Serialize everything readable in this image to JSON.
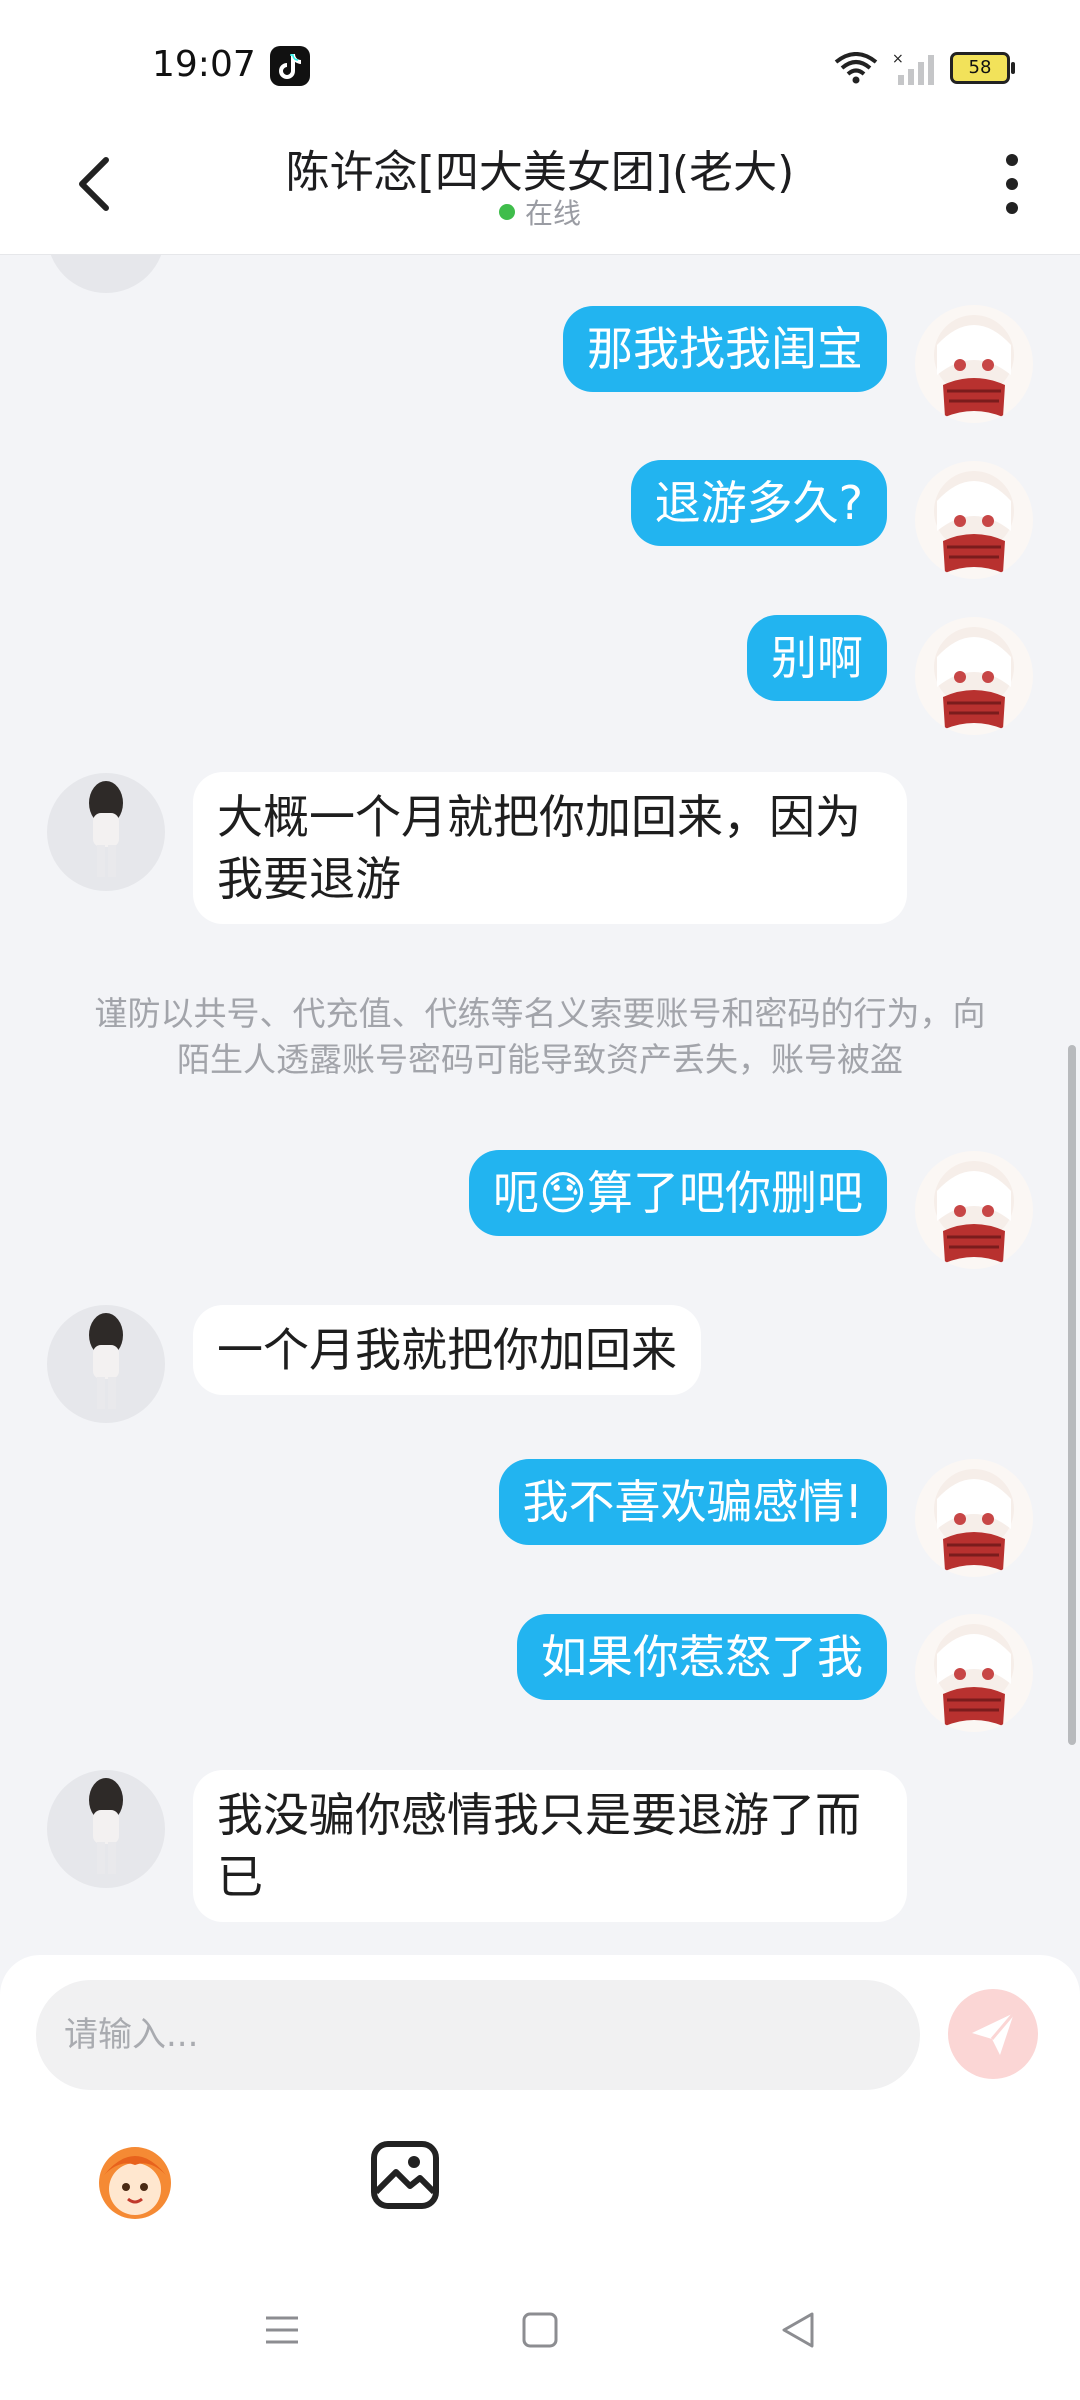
{
  "status_bar": {
    "time": "19:07",
    "battery": "58",
    "icons": [
      "tiktok-icon",
      "wifi-icon",
      "signal-icon",
      "battery-icon"
    ]
  },
  "header": {
    "title": "陈许念[四大美女团](老大)",
    "status": "在线",
    "status_color": "#3fbd4b"
  },
  "messages": [
    {
      "side": "me",
      "text": "那我找我闺宝"
    },
    {
      "side": "me",
      "text": "退游多久?"
    },
    {
      "side": "me",
      "text": "别啊"
    },
    {
      "side": "other",
      "text": "大概一个月就把你加回来，因为我要退游"
    },
    {
      "side": "notice",
      "text": "谨防以共号、代充值、代练等名义索要账号和密码的行为，向陌生人透露账号密码可能导致资产丢失，账号被盗"
    },
    {
      "side": "me",
      "text_before": "呃",
      "emoji": "😓",
      "text_after": "算了吧你删吧"
    },
    {
      "side": "other",
      "text": "一个月我就把你加回来"
    },
    {
      "side": "me",
      "text": "我不喜欢骗感情!"
    },
    {
      "side": "me",
      "text": "如果你惹怒了我"
    },
    {
      "side": "other",
      "text": "我没骗你感情我只是要退游了而已"
    }
  ],
  "input": {
    "placeholder": "请输入..."
  },
  "colors": {
    "my_bubble": "#22b4f0",
    "other_bubble": "#ffffff",
    "send_button": "#fbd6d5"
  }
}
